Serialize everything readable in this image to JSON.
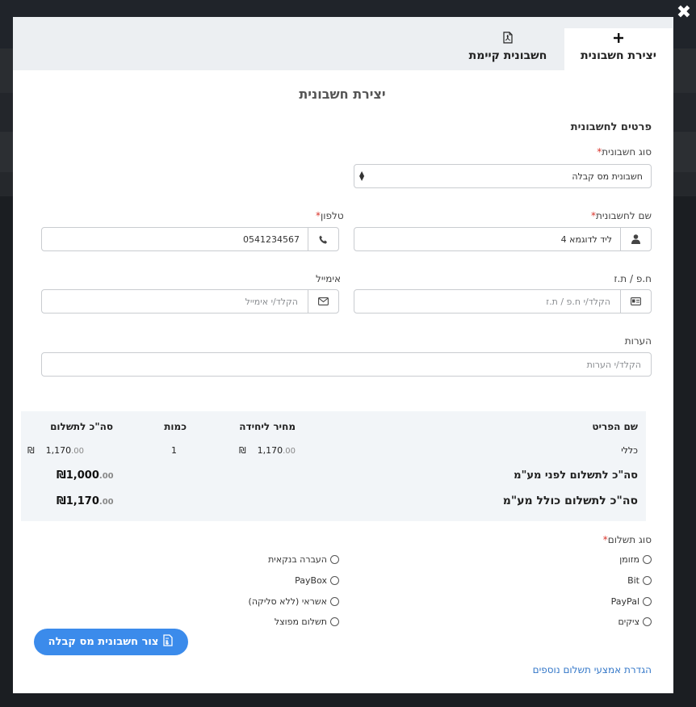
{
  "modal": {
    "tabs": [
      {
        "label": "יצירת חשבונית",
        "icon": "plus-icon"
      },
      {
        "label": "חשבונית קיימת",
        "icon": "pdf-file-icon"
      }
    ]
  },
  "form": {
    "title": "יצירת חשבונית",
    "section_title": "פרטים לחשבונית",
    "invoice_type": {
      "label": "סוג חשבונית",
      "value": "חשבונית מס קבלה"
    },
    "invoice_name": {
      "label": "שם לחשבונית",
      "value": "ליד לדוגמא 4"
    },
    "phone": {
      "label": "טלפון",
      "value": "0541234567"
    },
    "tax_id": {
      "label": "ח.פ / ת.ז",
      "placeholder": "הקלד/י ח.פ / ת.ז"
    },
    "email": {
      "label": "אימייל",
      "placeholder": "הקלד/י אימייל"
    },
    "notes": {
      "label": "הערות",
      "placeholder": "הקלד/י הערות"
    }
  },
  "items_table": {
    "headers": [
      "שם הפריט",
      "מחיר ליחידה",
      "כמות",
      "סה\"כ לתשלום"
    ],
    "rows": [
      {
        "name": "כללי",
        "unit_price": "1,170",
        "unit_cents": ".00",
        "qty": "1",
        "total": "1,170",
        "total_cents": ".00"
      }
    ],
    "currency": "₪",
    "subtotal_label": "סה\"כ לתשלום לפני מע\"מ",
    "subtotal_value": "1,000",
    "subtotal_cents": ".00",
    "total_label": "סה\"כ לתשלום כולל מע\"מ",
    "total_value": "1,170",
    "total_cents": ".00"
  },
  "payment": {
    "label": "סוג תשלום",
    "options_right": [
      "מזומן",
      "Bit",
      "PayPal",
      "ציקים"
    ],
    "options_left": [
      "העברה בנקאית",
      "PayBox",
      "אשראי (ללא סליקה)",
      "תשלום מפוצל"
    ]
  },
  "actions": {
    "submit_label": "צור חשבונית מס קבלה",
    "more_payments_link": "הגדרת אמצעי תשלום נוספים"
  },
  "colors": {
    "accent": "#3b8beb",
    "link": "#3377c8",
    "required": "#d9342b"
  }
}
